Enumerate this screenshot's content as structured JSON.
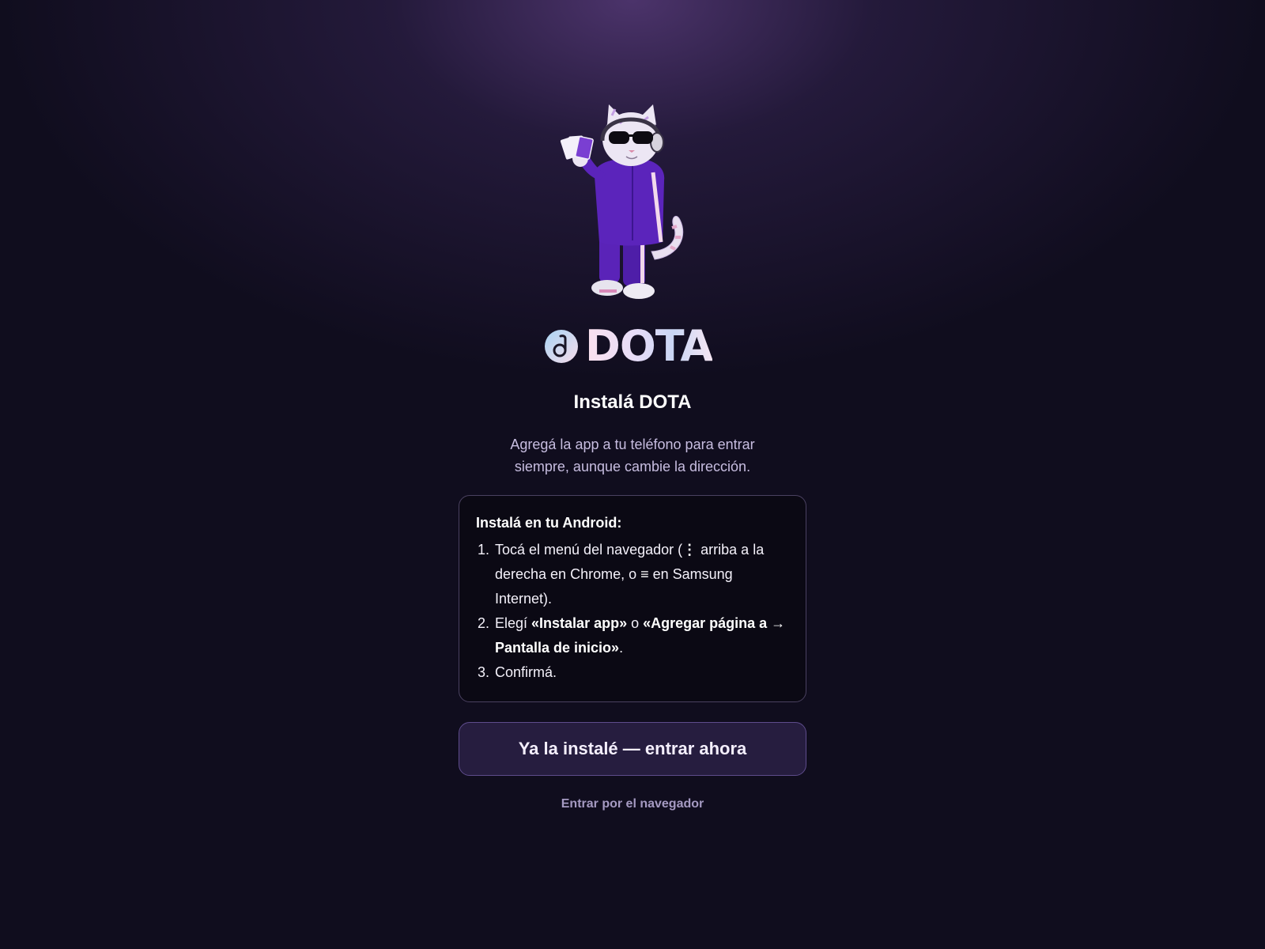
{
  "brand": {
    "name": "DOTA",
    "logo_icon": "d-circle-icon",
    "mascot": "cat-mascot-sunglasses-headphones-purple-tracksuit",
    "colors": {
      "background": "#100d1e",
      "glow": "#563a78",
      "button_bg": "#261d3f",
      "button_border": "#5e4c8c",
      "muted_text": "#c7bde0",
      "link": "#a59ac2"
    }
  },
  "header": {
    "title": "Instalá DOTA",
    "subtitle": "Agregá la app a tu teléfono para entrar siempre, aunque cambie la dirección."
  },
  "instructions": {
    "title": "Instalá en tu Android:",
    "steps": [
      {
        "prefix": "Tocá el menú del navegador (",
        "icon_kebab": "⋮",
        "middle": " arriba a la derecha en Chrome, o ",
        "icon_menu": "≡",
        "suffix": " en Samsung Internet)."
      },
      {
        "prefix": "Elegí ",
        "bold1": "«Instalar app»",
        "middle": " o ",
        "bold2": "«Agregar página a → Pantalla de inicio»",
        "suffix": "."
      },
      {
        "text": "Confirmá."
      }
    ]
  },
  "actions": {
    "primary_label": "Ya la instalé — entrar ahora",
    "secondary_label": "Entrar por el navegador"
  }
}
